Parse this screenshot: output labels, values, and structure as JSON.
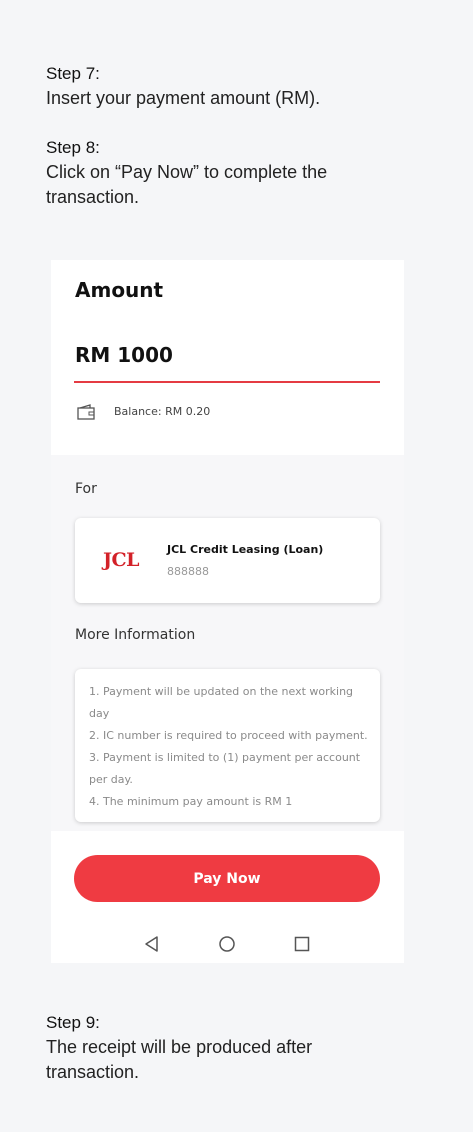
{
  "steps": [
    {
      "title": "Step 7:",
      "text": "Insert your payment amount (RM)."
    },
    {
      "title": "Step 8:",
      "text": "Click on “Pay Now” to complete the transaction."
    },
    {
      "title": "Step 9:",
      "text": "The receipt will be produced after transaction."
    }
  ],
  "screen": {
    "amount_title": "Amount",
    "amount_value": "RM 1000",
    "balance": "Balance: RM 0.20",
    "for_label": "For",
    "merchant": {
      "logo_text": "JCL",
      "name": "JCL Credit Leasing (Loan)",
      "account": "888888"
    },
    "more_info_label": "More Information",
    "info_items": [
      "1. Payment will be updated on the next working day",
      "2. IC number is required to proceed with payment.",
      "3. Payment is limited to (1) payment per account per day.",
      "4. The minimum pay amount is RM 1"
    ],
    "pay_button": "Pay Now",
    "nav_icons": [
      "back-icon",
      "home-icon",
      "recent-apps-icon"
    ]
  },
  "colors": {
    "accent": "#ef3b42",
    "logo": "#d32128",
    "background": "#f5f6f8"
  }
}
